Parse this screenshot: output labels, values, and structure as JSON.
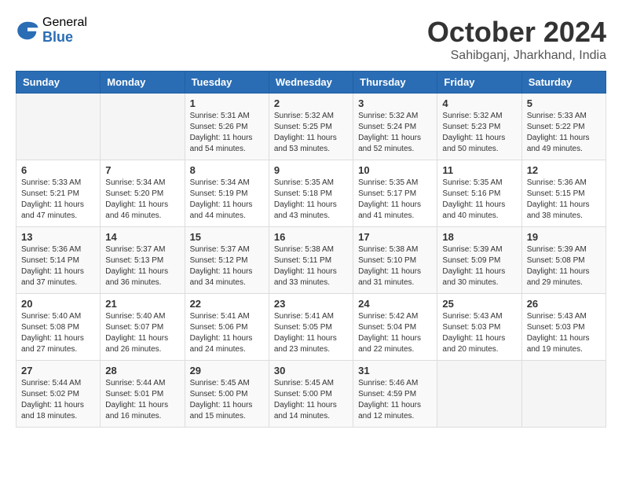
{
  "header": {
    "logo_general": "General",
    "logo_blue": "Blue",
    "month_title": "October 2024",
    "location": "Sahibganj, Jharkhand, India"
  },
  "weekdays": [
    "Sunday",
    "Monday",
    "Tuesday",
    "Wednesday",
    "Thursday",
    "Friday",
    "Saturday"
  ],
  "weeks": [
    [
      {
        "day": "",
        "sunrise": "",
        "sunset": "",
        "daylight": ""
      },
      {
        "day": "",
        "sunrise": "",
        "sunset": "",
        "daylight": ""
      },
      {
        "day": "1",
        "sunrise": "Sunrise: 5:31 AM",
        "sunset": "Sunset: 5:26 PM",
        "daylight": "Daylight: 11 hours and 54 minutes."
      },
      {
        "day": "2",
        "sunrise": "Sunrise: 5:32 AM",
        "sunset": "Sunset: 5:25 PM",
        "daylight": "Daylight: 11 hours and 53 minutes."
      },
      {
        "day": "3",
        "sunrise": "Sunrise: 5:32 AM",
        "sunset": "Sunset: 5:24 PM",
        "daylight": "Daylight: 11 hours and 52 minutes."
      },
      {
        "day": "4",
        "sunrise": "Sunrise: 5:32 AM",
        "sunset": "Sunset: 5:23 PM",
        "daylight": "Daylight: 11 hours and 50 minutes."
      },
      {
        "day": "5",
        "sunrise": "Sunrise: 5:33 AM",
        "sunset": "Sunset: 5:22 PM",
        "daylight": "Daylight: 11 hours and 49 minutes."
      }
    ],
    [
      {
        "day": "6",
        "sunrise": "Sunrise: 5:33 AM",
        "sunset": "Sunset: 5:21 PM",
        "daylight": "Daylight: 11 hours and 47 minutes."
      },
      {
        "day": "7",
        "sunrise": "Sunrise: 5:34 AM",
        "sunset": "Sunset: 5:20 PM",
        "daylight": "Daylight: 11 hours and 46 minutes."
      },
      {
        "day": "8",
        "sunrise": "Sunrise: 5:34 AM",
        "sunset": "Sunset: 5:19 PM",
        "daylight": "Daylight: 11 hours and 44 minutes."
      },
      {
        "day": "9",
        "sunrise": "Sunrise: 5:35 AM",
        "sunset": "Sunset: 5:18 PM",
        "daylight": "Daylight: 11 hours and 43 minutes."
      },
      {
        "day": "10",
        "sunrise": "Sunrise: 5:35 AM",
        "sunset": "Sunset: 5:17 PM",
        "daylight": "Daylight: 11 hours and 41 minutes."
      },
      {
        "day": "11",
        "sunrise": "Sunrise: 5:35 AM",
        "sunset": "Sunset: 5:16 PM",
        "daylight": "Daylight: 11 hours and 40 minutes."
      },
      {
        "day": "12",
        "sunrise": "Sunrise: 5:36 AM",
        "sunset": "Sunset: 5:15 PM",
        "daylight": "Daylight: 11 hours and 38 minutes."
      }
    ],
    [
      {
        "day": "13",
        "sunrise": "Sunrise: 5:36 AM",
        "sunset": "Sunset: 5:14 PM",
        "daylight": "Daylight: 11 hours and 37 minutes."
      },
      {
        "day": "14",
        "sunrise": "Sunrise: 5:37 AM",
        "sunset": "Sunset: 5:13 PM",
        "daylight": "Daylight: 11 hours and 36 minutes."
      },
      {
        "day": "15",
        "sunrise": "Sunrise: 5:37 AM",
        "sunset": "Sunset: 5:12 PM",
        "daylight": "Daylight: 11 hours and 34 minutes."
      },
      {
        "day": "16",
        "sunrise": "Sunrise: 5:38 AM",
        "sunset": "Sunset: 5:11 PM",
        "daylight": "Daylight: 11 hours and 33 minutes."
      },
      {
        "day": "17",
        "sunrise": "Sunrise: 5:38 AM",
        "sunset": "Sunset: 5:10 PM",
        "daylight": "Daylight: 11 hours and 31 minutes."
      },
      {
        "day": "18",
        "sunrise": "Sunrise: 5:39 AM",
        "sunset": "Sunset: 5:09 PM",
        "daylight": "Daylight: 11 hours and 30 minutes."
      },
      {
        "day": "19",
        "sunrise": "Sunrise: 5:39 AM",
        "sunset": "Sunset: 5:08 PM",
        "daylight": "Daylight: 11 hours and 29 minutes."
      }
    ],
    [
      {
        "day": "20",
        "sunrise": "Sunrise: 5:40 AM",
        "sunset": "Sunset: 5:08 PM",
        "daylight": "Daylight: 11 hours and 27 minutes."
      },
      {
        "day": "21",
        "sunrise": "Sunrise: 5:40 AM",
        "sunset": "Sunset: 5:07 PM",
        "daylight": "Daylight: 11 hours and 26 minutes."
      },
      {
        "day": "22",
        "sunrise": "Sunrise: 5:41 AM",
        "sunset": "Sunset: 5:06 PM",
        "daylight": "Daylight: 11 hours and 24 minutes."
      },
      {
        "day": "23",
        "sunrise": "Sunrise: 5:41 AM",
        "sunset": "Sunset: 5:05 PM",
        "daylight": "Daylight: 11 hours and 23 minutes."
      },
      {
        "day": "24",
        "sunrise": "Sunrise: 5:42 AM",
        "sunset": "Sunset: 5:04 PM",
        "daylight": "Daylight: 11 hours and 22 minutes."
      },
      {
        "day": "25",
        "sunrise": "Sunrise: 5:43 AM",
        "sunset": "Sunset: 5:03 PM",
        "daylight": "Daylight: 11 hours and 20 minutes."
      },
      {
        "day": "26",
        "sunrise": "Sunrise: 5:43 AM",
        "sunset": "Sunset: 5:03 PM",
        "daylight": "Daylight: 11 hours and 19 minutes."
      }
    ],
    [
      {
        "day": "27",
        "sunrise": "Sunrise: 5:44 AM",
        "sunset": "Sunset: 5:02 PM",
        "daylight": "Daylight: 11 hours and 18 minutes."
      },
      {
        "day": "28",
        "sunrise": "Sunrise: 5:44 AM",
        "sunset": "Sunset: 5:01 PM",
        "daylight": "Daylight: 11 hours and 16 minutes."
      },
      {
        "day": "29",
        "sunrise": "Sunrise: 5:45 AM",
        "sunset": "Sunset: 5:00 PM",
        "daylight": "Daylight: 11 hours and 15 minutes."
      },
      {
        "day": "30",
        "sunrise": "Sunrise: 5:45 AM",
        "sunset": "Sunset: 5:00 PM",
        "daylight": "Daylight: 11 hours and 14 minutes."
      },
      {
        "day": "31",
        "sunrise": "Sunrise: 5:46 AM",
        "sunset": "Sunset: 4:59 PM",
        "daylight": "Daylight: 11 hours and 12 minutes."
      },
      {
        "day": "",
        "sunrise": "",
        "sunset": "",
        "daylight": ""
      },
      {
        "day": "",
        "sunrise": "",
        "sunset": "",
        "daylight": ""
      }
    ]
  ]
}
